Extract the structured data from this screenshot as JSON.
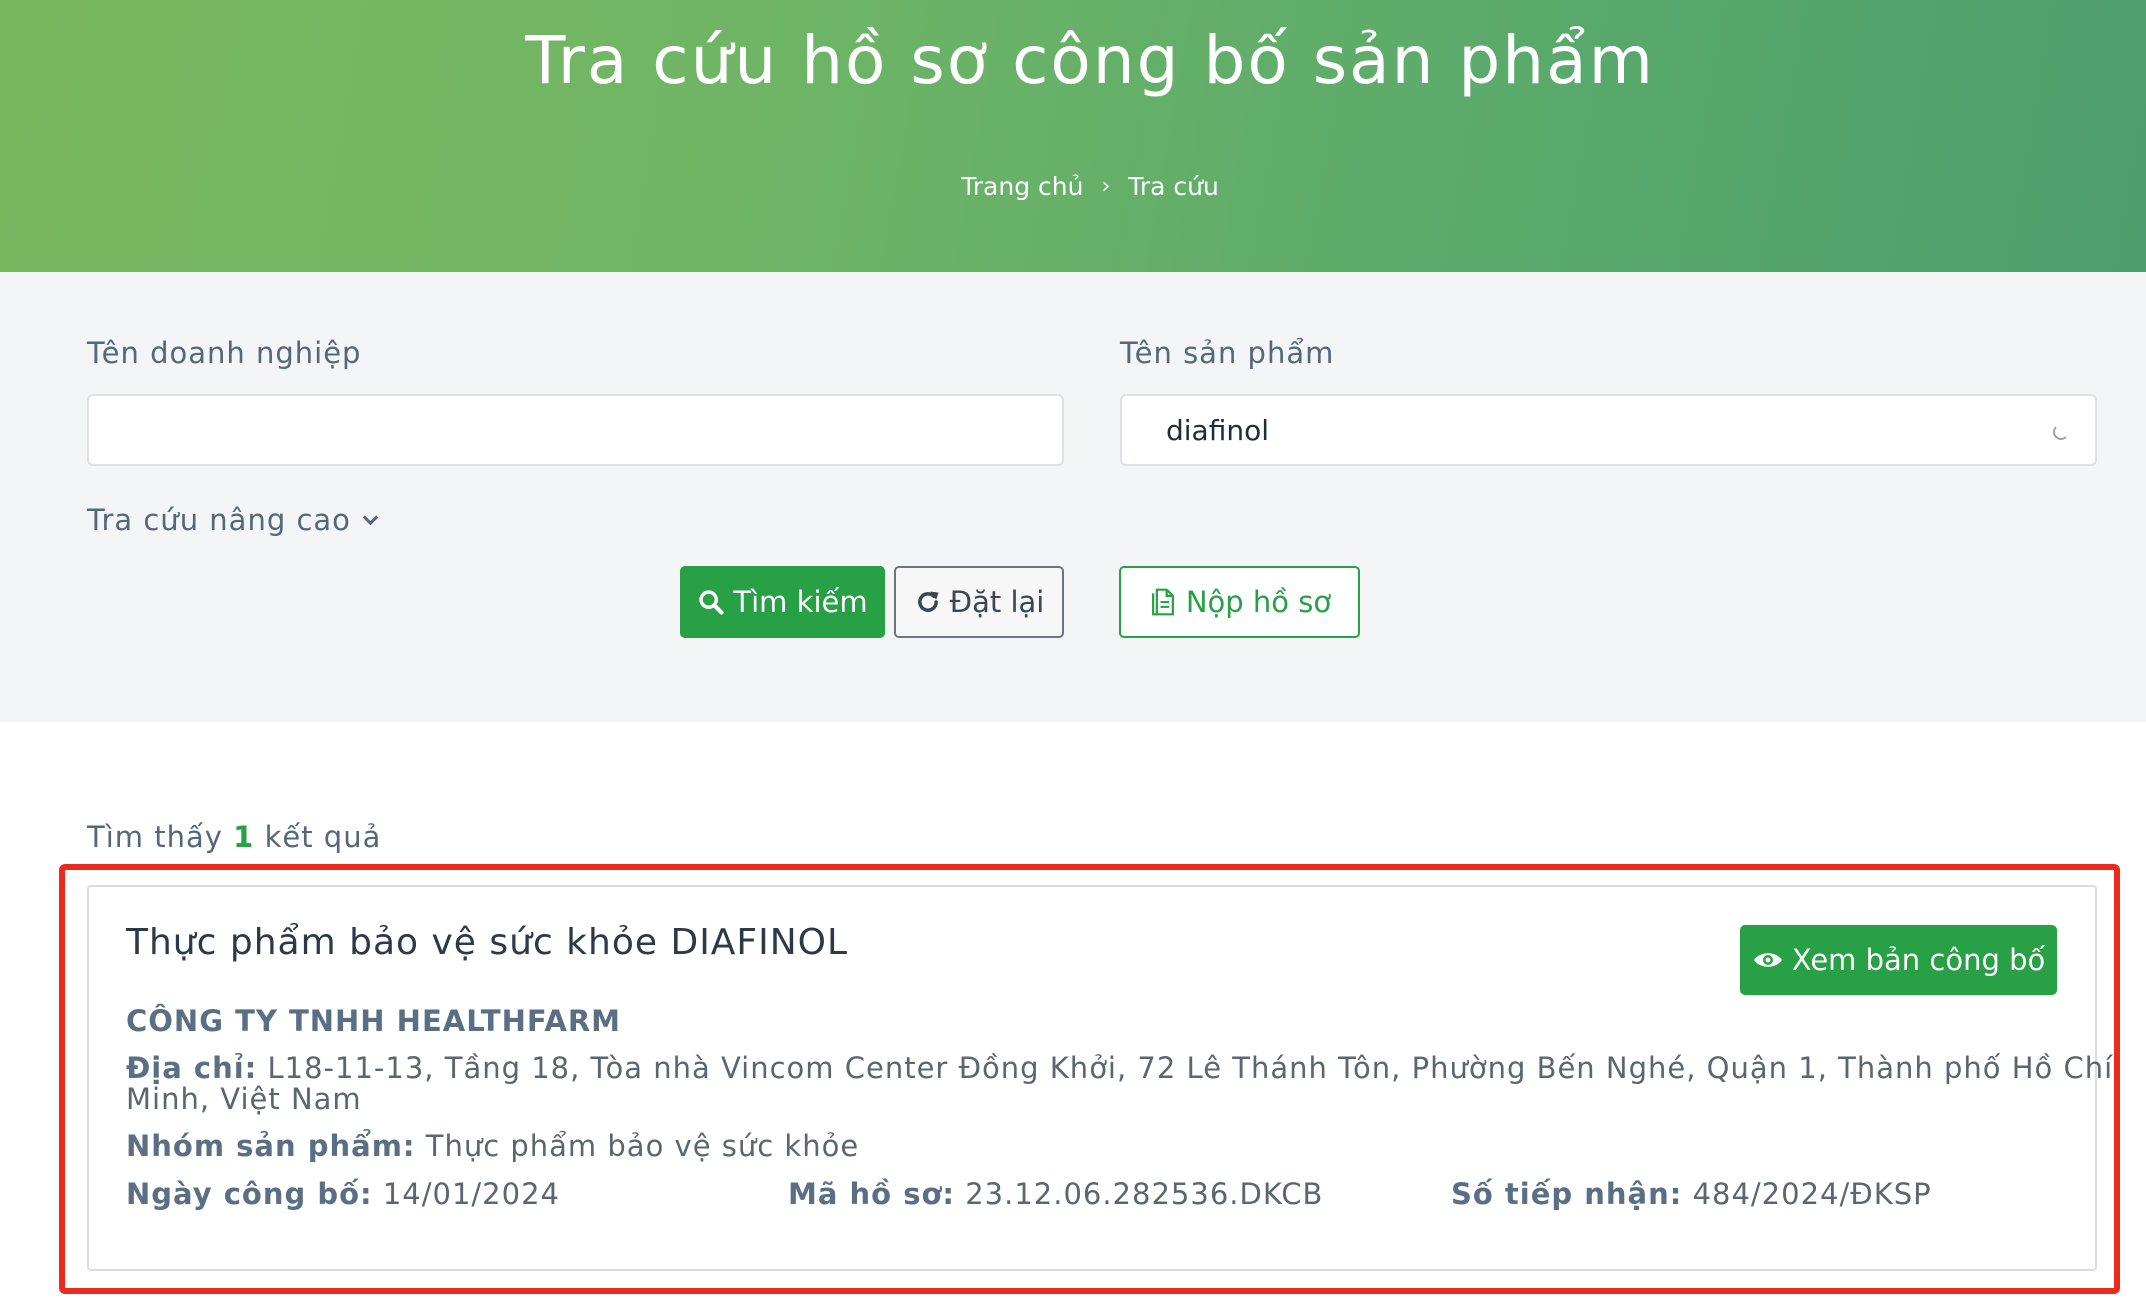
{
  "header": {
    "title": "Tra cứu hồ sơ công bố sản phẩm",
    "breadcrumb": {
      "home": "Trang chủ",
      "separator": "›",
      "current": "Tra cứu"
    }
  },
  "search": {
    "company_label": "Tên doanh nghiệp",
    "company_value": "",
    "product_label": "Tên sản phẩm",
    "product_value": "diafinol",
    "advanced_label": "Tra cứu nâng cao",
    "search_button": "Tìm kiếm",
    "reset_button": "Đặt lại",
    "submit_button": "Nộp hồ sơ"
  },
  "results": {
    "prefix": "Tìm thấy",
    "count": "1",
    "suffix": "kết quả",
    "items": [
      {
        "title": "Thực phẩm bảo vệ sức khỏe DIAFINOL",
        "view_button": "Xem bản công bố",
        "company": "CÔNG TY TNHH HEALTHFARM",
        "address_label": "Địa chỉ:",
        "address_line1": "L18-11-13, Tầng 18, Tòa nhà Vincom Center Đồng Khởi, 72 Lê Thánh Tôn, Phường Bến Nghé, Quận 1, Thành phố Hồ Chí",
        "address_line2": "Minh, Việt Nam",
        "group_label": "Nhóm sản phẩm:",
        "group_value": "Thực phẩm bảo vệ sức khỏe",
        "date_label": "Ngày công bố:",
        "date_value": "14/01/2024",
        "code_label": "Mã hồ sơ:",
        "code_value": "23.12.06.282536.DKCB",
        "receipt_label": "Số tiếp nhận:",
        "receipt_value": "484/2024/ĐKSP"
      }
    ]
  },
  "colors": {
    "primary_green": "#27a046",
    "highlight_red": "#ee2a1e",
    "panel_bg": "#f4f5f7"
  },
  "icons": {
    "search": "search-icon",
    "reset": "refresh-icon",
    "submit": "document-icon",
    "view": "eye-icon",
    "advanced": "chevron-down-icon",
    "loading": "spinner-icon"
  }
}
